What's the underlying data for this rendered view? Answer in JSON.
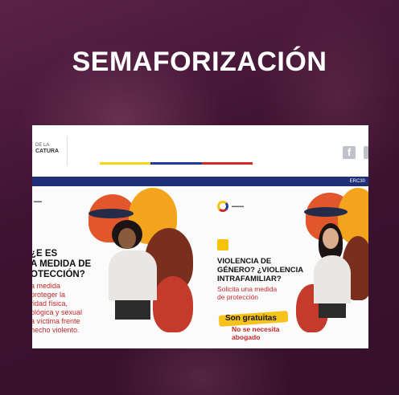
{
  "headline": "SEMAFORIZACIÓN",
  "website": {
    "logo_line1": "DE LA",
    "logo_line2": "CATURA",
    "facebook_icon": "f",
    "nav_right": "ERC30"
  },
  "banner_left": {
    "title_lines": [
      "¿E ES",
      "A MEDIDA DE",
      "OTECCIÓN?"
    ],
    "body_lines": [
      "a medida",
      "proteger la",
      "ridad física,",
      "ológica y sexual",
      "a víctima frente",
      "hecho violento."
    ]
  },
  "banner_right": {
    "title_lines": [
      "VIOLENCIA DE",
      "GÉNERO? ¿VIOLENCIA",
      "INTRAFAMILIAR?"
    ],
    "subtitle_lines": [
      "Solicita una medida",
      "de protección"
    ],
    "free_label": "Son gratuitas",
    "free_sub_lines": [
      "No se necesita",
      "abogado"
    ]
  },
  "colors": {
    "background": "#3f1330",
    "flag_yellow": "#f7d417",
    "flag_blue": "#1f3c9a",
    "flag_red": "#d62828",
    "nav_blue": "#1e2f78",
    "accent_red": "#c62828",
    "accent_yellow": "#f5c31b"
  }
}
